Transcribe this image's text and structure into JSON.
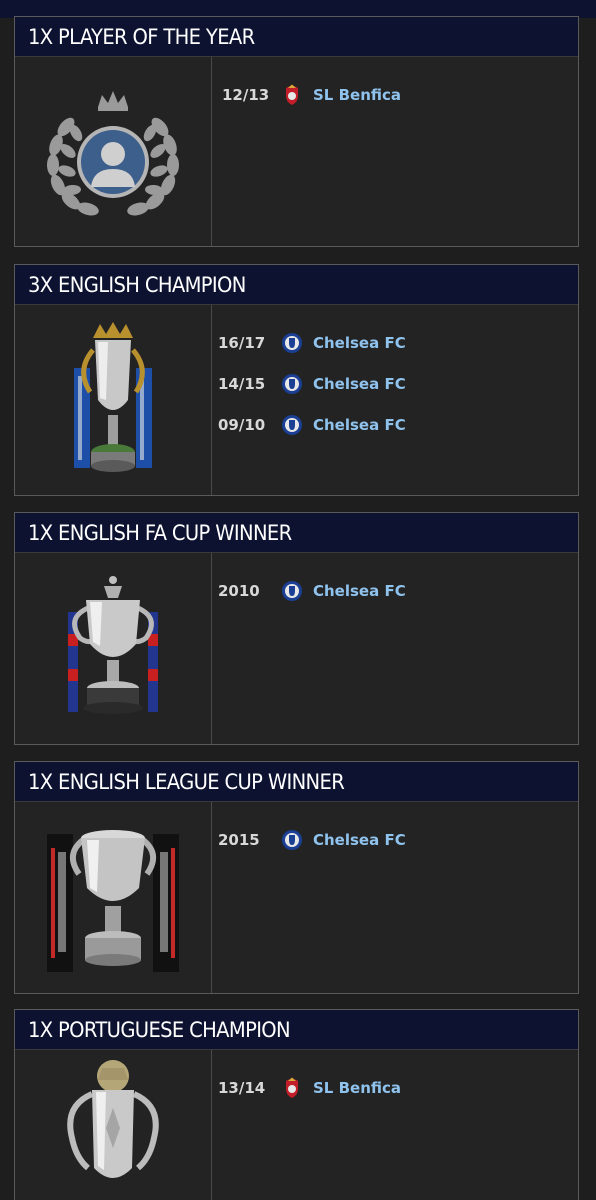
{
  "awards": [
    {
      "title": "1X PLAYER OF THE YEAR",
      "trophy_icon": "laurel-wreath-player-icon",
      "entries": [
        {
          "season": "12/13",
          "club": "SL Benfica",
          "club_icon": "benfica-crest-icon"
        }
      ]
    },
    {
      "title": "3X ENGLISH CHAMPION",
      "trophy_icon": "premier-league-trophy-icon",
      "entries": [
        {
          "season": "16/17",
          "club": "Chelsea FC",
          "club_icon": "chelsea-crest-icon"
        },
        {
          "season": "14/15",
          "club": "Chelsea FC",
          "club_icon": "chelsea-crest-icon"
        },
        {
          "season": "09/10",
          "club": "Chelsea FC",
          "club_icon": "chelsea-crest-icon"
        }
      ]
    },
    {
      "title": "1X ENGLISH FA CUP WINNER",
      "trophy_icon": "fa-cup-trophy-icon",
      "entries": [
        {
          "season": "2010",
          "club": "Chelsea FC",
          "club_icon": "chelsea-crest-icon"
        }
      ]
    },
    {
      "title": "1X ENGLISH LEAGUE CUP WINNER",
      "trophy_icon": "league-cup-trophy-icon",
      "entries": [
        {
          "season": "2015",
          "club": "Chelsea FC",
          "club_icon": "chelsea-crest-icon"
        }
      ]
    },
    {
      "title": "1X PORTUGUESE CHAMPION",
      "trophy_icon": "portuguese-league-trophy-icon",
      "entries": [
        {
          "season": "13/14",
          "club": "SL Benfica",
          "club_icon": "benfica-crest-icon"
        }
      ]
    }
  ],
  "colors": {
    "header_bg": "#0c1230",
    "card_bg": "#232323",
    "link": "#8fc3ee",
    "season_text": "#d8d8d8"
  }
}
